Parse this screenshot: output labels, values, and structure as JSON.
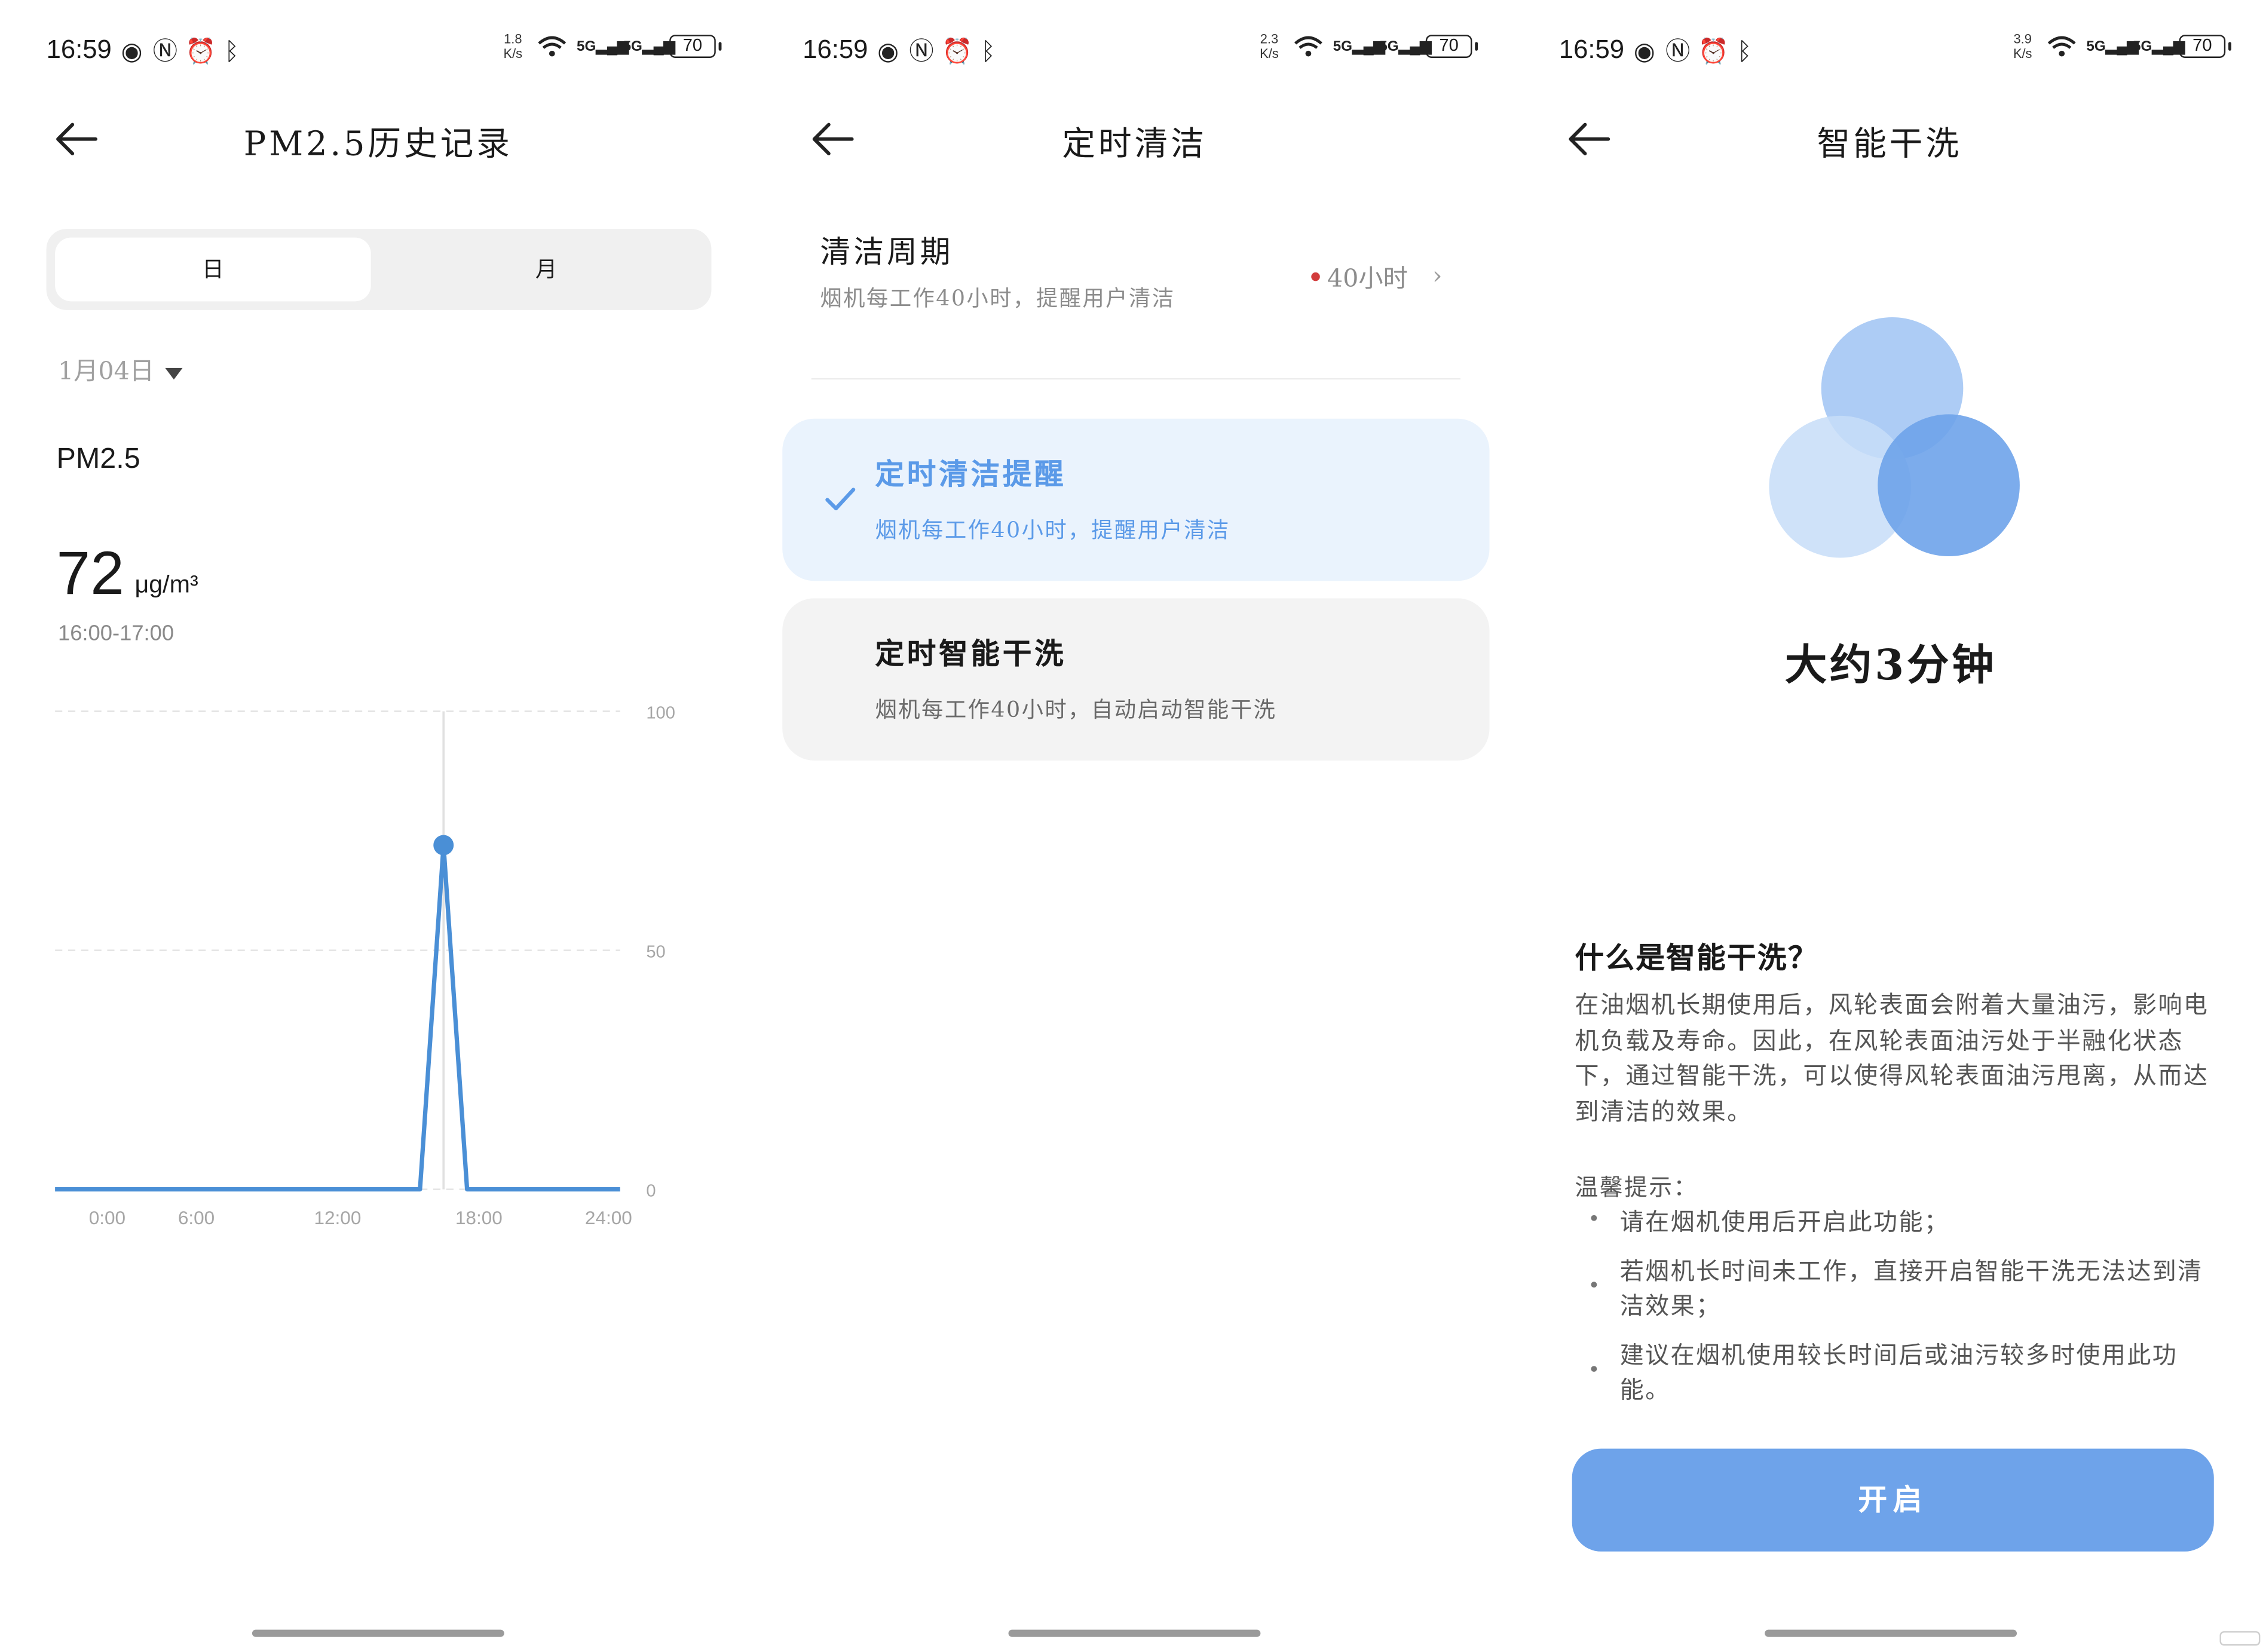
{
  "status_bar": {
    "time": "16:59",
    "battery": "70",
    "speeds": [
      "1.8",
      "2.3",
      "3.9"
    ],
    "speed_unit": "K/s",
    "net_labels": [
      "5G",
      "5G"
    ]
  },
  "panel1": {
    "title": "PM2.5历史记录",
    "tabs": [
      "日",
      "月"
    ],
    "date": "1月04日",
    "metric_label": "PM2.5",
    "metric_value": "72",
    "metric_unit": "μg/m³",
    "time_range": "16:00-17:00"
  },
  "panel2": {
    "title": "定时清洁",
    "cycle_title": "清洁周期",
    "cycle_sub": "烟机每工作40小时，提醒用户清洁",
    "cycle_value": "40小时",
    "options": [
      {
        "title": "定时清洁提醒",
        "sub": "烟机每工作40小时，提醒用户清洁",
        "selected": true
      },
      {
        "title": "定时智能干洗",
        "sub": "烟机每工作40小时，自动启动智能干洗",
        "selected": false
      }
    ]
  },
  "panel3": {
    "title": "智能干洗",
    "duration": "大约3分钟",
    "question": "什么是智能干洗？",
    "description": "在油烟机长期使用后，风轮表面会附着大量油污，影响电机负载及寿命。因此，在风轮表面油污处于半融化状态下，通过智能干洗，可以使得风轮表面油污甩离，从而达到清洁的效果。",
    "tips_title": "温馨提示：",
    "tips": [
      "请在烟机使用后开启此功能；",
      "若烟机长时间未工作，直接开启智能干洗无法达到清洁效果；",
      "建议在烟机使用较长时间后或油污较多时使用此功能。"
    ],
    "button": "开启"
  },
  "colors": {
    "accent": "#5b9ae8",
    "button": "#6ea3ea",
    "chart_line": "#4a8fd6",
    "selected_card_bg": "#eaf3fd"
  },
  "chart_data": {
    "type": "line",
    "x_labels": [
      "0:00",
      "6:00",
      "12:00",
      "18:00",
      "24:00"
    ],
    "y_ticks": [
      0,
      50,
      100
    ],
    "ylim": [
      0,
      100
    ],
    "xlim": [
      0,
      24
    ],
    "x": [
      0,
      15.5,
      16.5,
      17.5,
      24
    ],
    "y": [
      0,
      0,
      72,
      0,
      0
    ],
    "highlight": {
      "x": 16.5,
      "y": 72
    },
    "grid": true
  }
}
